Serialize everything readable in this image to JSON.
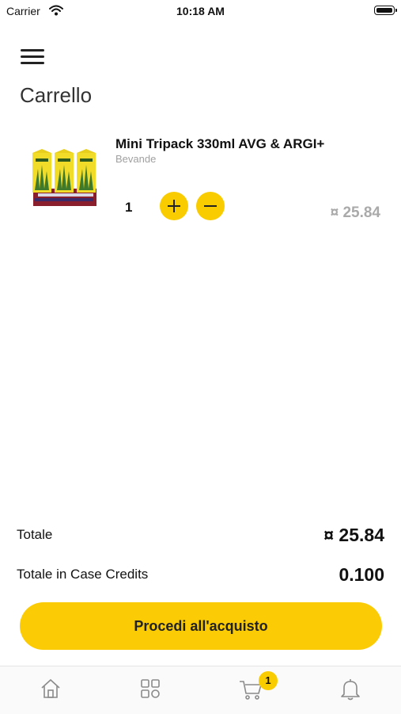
{
  "status_bar": {
    "carrier": "Carrier",
    "time": "10:18 AM"
  },
  "header": {
    "title": "Carrello",
    "menu_icon": "hamburger-menu-icon"
  },
  "cart": {
    "items": [
      {
        "name": "Mini Tripack 330ml AVG & ARGI+",
        "category": "Bevande",
        "quantity": "1",
        "price": "¤ 25.84"
      }
    ]
  },
  "totals": {
    "total_label": "Totale",
    "total_value": "¤ 25.84",
    "credits_label": "Totale in Case Credits",
    "credits_value": "0.100"
  },
  "checkout": {
    "label": "Procedi all'acquisto"
  },
  "tabbar": {
    "items": [
      "home-icon",
      "categories-grid-icon",
      "cart-icon",
      "bell-icon"
    ],
    "cart_badge": "1"
  },
  "colors": {
    "accent": "#F9CC00",
    "muted": "#AAAAAA"
  }
}
